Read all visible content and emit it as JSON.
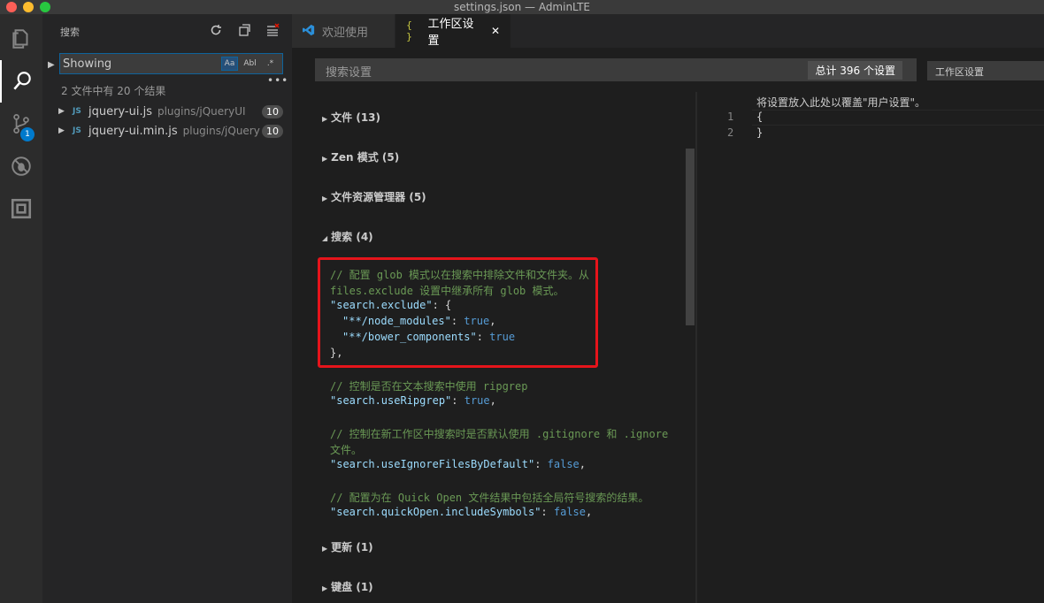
{
  "window": {
    "title": "settings.json — AdminLTE"
  },
  "activity": {
    "scm_badge": "1"
  },
  "sidebar": {
    "header": "搜索",
    "search_value": "Showing",
    "opt_case": "Aa",
    "opt_word": "Abl",
    "opt_regex": ".*",
    "more": "•••",
    "summary": "2 文件中有 20 个结果",
    "files": [
      {
        "icon": "JS",
        "name": "jquery-ui.js",
        "path": "plugins/jQueryUI",
        "count": "10"
      },
      {
        "icon": "JS",
        "name": "jquery-ui.min.js",
        "path": "plugins/jQueryUI",
        "count": "10"
      }
    ]
  },
  "tabs": [
    {
      "label": "欢迎使用"
    },
    {
      "icon": "{ }",
      "label": "工作区设置",
      "close": "✕"
    }
  ],
  "settings_search": {
    "placeholder": "搜索设置",
    "total": "总计 396 个设置"
  },
  "scope": {
    "selected": "工作区设置"
  },
  "sections": {
    "files": "文件 (13)",
    "zen": "Zen 模式 (5)",
    "explorer": "文件资源管理器 (5)",
    "search": "搜索 (4)",
    "update": "更新 (1)",
    "keyboard": "键盘 (1)"
  },
  "code": {
    "c1a": "// 配置 glob 模式以在搜索中排除文件和文件夹。从",
    "c1b": "files.exclude 设置中继承所有 glob 模式。",
    "k1": "\"search.exclude\"",
    "p1": ": {",
    "k1a": "\"**/node_modules\"",
    "v1a": "true",
    "k1b": "\"**/bower_components\"",
    "v1b": "true",
    "close1": "},",
    "c2": "// 控制是否在文本搜索中使用 ripgrep",
    "k2": "\"search.useRipgrep\"",
    "v2": "true",
    "c3a": "// 控制在新工作区中搜索时是否默认使用 .gitignore 和 .ignore",
    "c3b": "文件。",
    "k3": "\"search.useIgnoreFilesByDefault\"",
    "v3": "false",
    "c4": "// 配置为在 Quick Open 文件结果中包括全局符号搜索的结果。",
    "k4": "\"search.quickOpen.includeSymbols\"",
    "v4": "false"
  },
  "workspace": {
    "hint": "将设置放入此处以覆盖\"用户设置\"。",
    "line1": "1",
    "line2": "2",
    "l1": "{",
    "l2": "}"
  }
}
